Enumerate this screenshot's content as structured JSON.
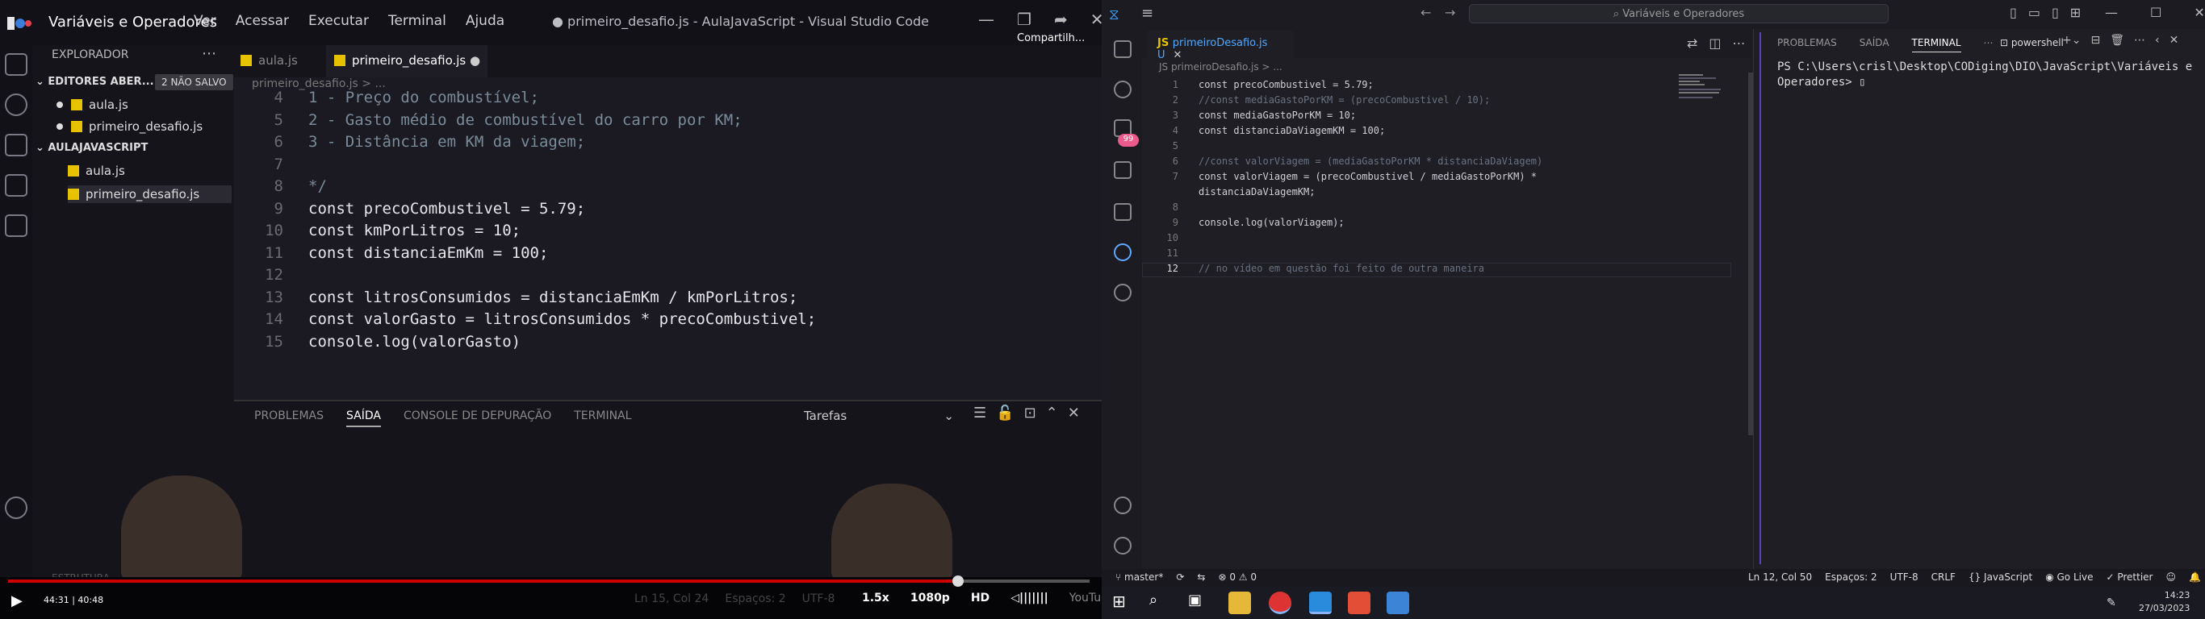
{
  "video": {
    "channel": "Variáveis e Operadores",
    "menu": [
      "Ver",
      "Acessar",
      "Executar",
      "Terminal",
      "Ajuda"
    ],
    "window_title": "● primeiro_desafio.js - AulaJavaScript - Visual Studio Code",
    "share_label": "Compartilh...",
    "explorer_title": "EXPLORADOR",
    "editors_open": "EDITORES ABER...",
    "unsaved_badge": "2 NÃO SALVO",
    "open_files": [
      "aula.js",
      "primeiro_desafio.js"
    ],
    "project": "AULAJAVASCRIPT",
    "project_files": [
      "aula.js",
      "primeiro_desafio.js"
    ],
    "tab1": "aula.js",
    "tab2": "primeiro_desafio.js",
    "breadcrumb": "primeiro_desafio.js > ...",
    "code_lines": [
      {
        "n": "4",
        "t": "1 - Preço do combustível;"
      },
      {
        "n": "5",
        "t": "2 - Gasto médio de combustível do carro por KM;"
      },
      {
        "n": "6",
        "t": "3 - Distância em KM da viagem;"
      },
      {
        "n": "7",
        "t": ""
      },
      {
        "n": "8",
        "t": "*/"
      },
      {
        "n": "9",
        "t": "const precoCombustivel = 5.79;"
      },
      {
        "n": "10",
        "t": "const kmPorLitros = 10;"
      },
      {
        "n": "11",
        "t": "const distanciaEmKm = 100;"
      },
      {
        "n": "12",
        "t": ""
      },
      {
        "n": "13",
        "t": "const litrosConsumidos = distanciaEmKm / kmPorLitros;"
      },
      {
        "n": "14",
        "t": "const valorGasto = litrosConsumidos * precoCombustivel;"
      },
      {
        "n": "15",
        "t": "console.log(valorGasto)"
      }
    ],
    "panel_tabs": [
      "PROBLEMAS",
      "SAÍDA",
      "CONSOLE DE DEPURAÇÃO",
      "TERMINAL"
    ],
    "output_select": "Tarefas",
    "status_faint": [
      "Ln 15, Col 24",
      "Espaços: 2",
      "UTF-8"
    ],
    "time": "44:31 | 40:48",
    "speed": "1.5x",
    "quality": "1080p",
    "hd": "HD",
    "sidebar_bottom": "ESTRUTURA",
    "watermark": "YouTube"
  },
  "vscode": {
    "search": "Variáveis e Operadores",
    "tab": "primeiroDesafio.js U",
    "breadcrumb": "JS primeiroDesafio.js > ...",
    "badge": "99",
    "lines": [
      {
        "n": "1",
        "t": "const precoCombustivel = 5.79;"
      },
      {
        "n": "2",
        "t": "//const mediaGastoPorKM = (precoCombustivel / 10);"
      },
      {
        "n": "3",
        "t": "const mediaGastoPorKM = 10;"
      },
      {
        "n": "4",
        "t": "const distanciaDaViagemKM = 100;"
      },
      {
        "n": "5",
        "t": ""
      },
      {
        "n": "6",
        "t": "//const valorViagem = (mediaGastoPorKM * distanciaDaViagem)"
      },
      {
        "n": "7",
        "t": "const valorViagem = (precoCombustivel / mediaGastoPorKM) *"
      },
      {
        "n": "",
        "t": "distanciaDaViagemKM;"
      },
      {
        "n": "8",
        "t": ""
      },
      {
        "n": "9",
        "t": "console.log(valorViagem);"
      },
      {
        "n": "10",
        "t": ""
      },
      {
        "n": "11",
        "t": ""
      },
      {
        "n": "12",
        "t": "// no vídeo em questão foi feito de outra maneira"
      }
    ],
    "term_tabs": [
      "PROBLEMAS",
      "SAÍDA",
      "TERMINAL"
    ],
    "shell": "powershell",
    "terminal_text": "PS C:\\Users\\crisl\\Desktop\\CODiging\\DIO\\JavaScript\\Variáveis e Operadores> ▯",
    "status_left": [
      "master*",
      "⊗ 0 ⚠ 0"
    ],
    "status_right": [
      "Ln 12, Col 50",
      "Espaços: 2",
      "UTF-8",
      "CRLF",
      "{} JavaScript",
      "Go Live",
      "Prettier"
    ],
    "clock_time": "14:23",
    "clock_date": "27/03/2023"
  }
}
